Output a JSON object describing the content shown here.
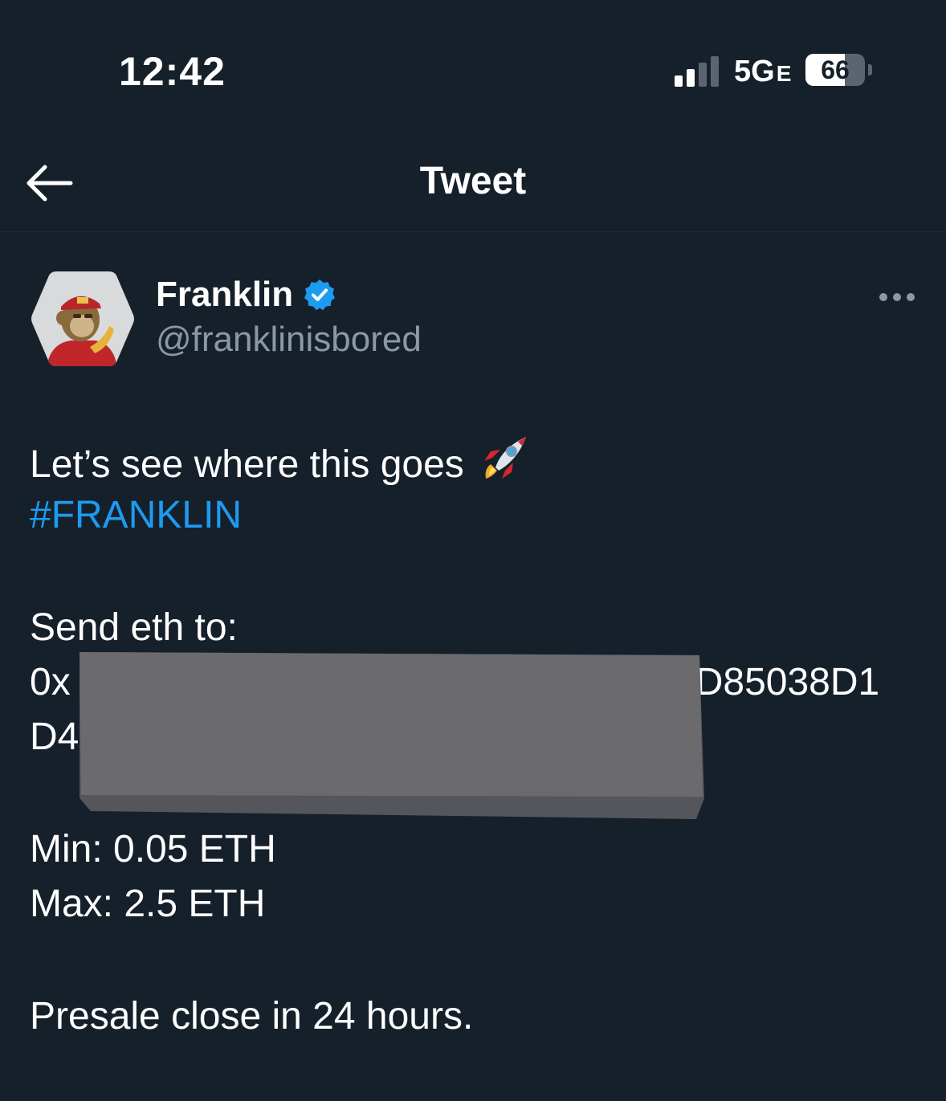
{
  "status_bar": {
    "time": "12:42",
    "network": "5G",
    "network_suffix": "E",
    "battery_text": "66",
    "battery_level": 0.66
  },
  "header": {
    "title": "Tweet",
    "back_icon": "arrow-left-icon"
  },
  "author": {
    "display_name": "Franklin",
    "handle": "@franklinisbored",
    "verified_icon": "verified-badge-icon",
    "avatar": "avatar-image",
    "more_icon": "more-horizontal-icon"
  },
  "tweet": {
    "line1": "Let’s see where this goes",
    "rocket_icon": "rocket-emoji-icon",
    "hashtag": "#FRANKLIN",
    "send_label": "Send eth to:",
    "address_line1_start": "0x",
    "address_line1_end": "D85038D1",
    "address_line2_start": "D4",
    "min": "Min: 0.05 ETH",
    "max": "Max: 2.5 ETH",
    "presale": "Presale close in 24 hours."
  },
  "colors": {
    "background": "#15202b",
    "text": "#ffffff",
    "secondary_text": "#8b98a5",
    "accent": "#1d9bf0",
    "redaction": "#6b6b6e"
  }
}
